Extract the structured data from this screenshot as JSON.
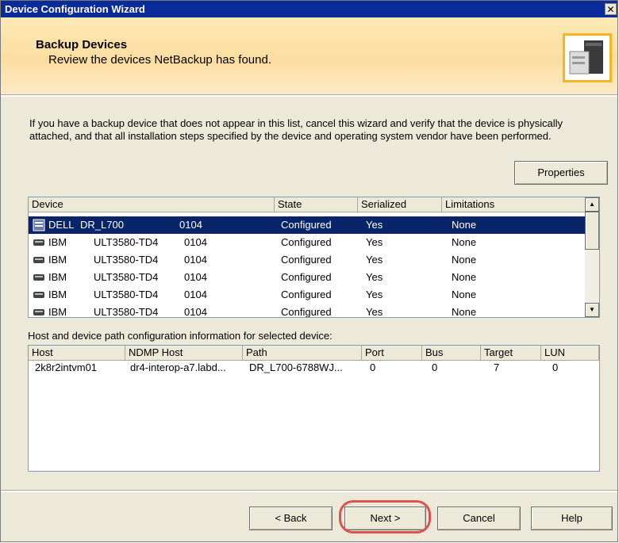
{
  "window": {
    "title": "Device Configuration Wizard",
    "close_glyph": "✕"
  },
  "header": {
    "title": "Backup Devices",
    "subtitle": "Review the devices NetBackup has found.",
    "icon": "tape-drive-icon"
  },
  "intro_text": "If you have a backup device that does not appear in this list, cancel this wizard and verify that the device is physically attached, and that all installation steps specified by the device and operating system vendor have been performed.",
  "properties_label": "Properties",
  "devices": {
    "columns": [
      "Device",
      "State",
      "Serialized",
      "Limitations"
    ],
    "rows": [
      {
        "vendor": "DELL",
        "model": "DR_L700",
        "rev": "0104",
        "state": "Configured",
        "serialized": "Yes",
        "limitations": "None"
      },
      {
        "vendor": "IBM",
        "model": "ULT3580-TD4",
        "rev": "0104",
        "state": "Configured",
        "serialized": "Yes",
        "limitations": "None"
      },
      {
        "vendor": "IBM",
        "model": "ULT3580-TD4",
        "rev": "0104",
        "state": "Configured",
        "serialized": "Yes",
        "limitations": "None"
      },
      {
        "vendor": "IBM",
        "model": "ULT3580-TD4",
        "rev": "0104",
        "state": "Configured",
        "serialized": "Yes",
        "limitations": "None"
      },
      {
        "vendor": "IBM",
        "model": "ULT3580-TD4",
        "rev": "0104",
        "state": "Configured",
        "serialized": "Yes",
        "limitations": "None"
      },
      {
        "vendor": "IBM",
        "model": "ULT3580-TD4",
        "rev": "0104",
        "state": "Configured",
        "serialized": "Yes",
        "limitations": "None"
      }
    ],
    "scroll_up_glyph": "▲",
    "scroll_down_glyph": "▼"
  },
  "path_label": "Host and device path configuration information for selected device:",
  "paths": {
    "columns": [
      "Host",
      "NDMP Host",
      "Path",
      "Port",
      "Bus",
      "Target",
      "LUN"
    ],
    "rows": [
      [
        "2k8r2intvm01",
        "dr4-interop-a7.labd...",
        "DR_L700-6788WJ...",
        "0",
        "0",
        "7",
        "0"
      ]
    ]
  },
  "buttons": {
    "back": "< Back",
    "next": "Next >",
    "cancel": "Cancel",
    "help": "Help"
  },
  "colors": {
    "title_bar": "#0a2c9a",
    "selection": "#0a246a",
    "header_bg": "#fbdda0",
    "highlight_ring": "#d9534f"
  }
}
